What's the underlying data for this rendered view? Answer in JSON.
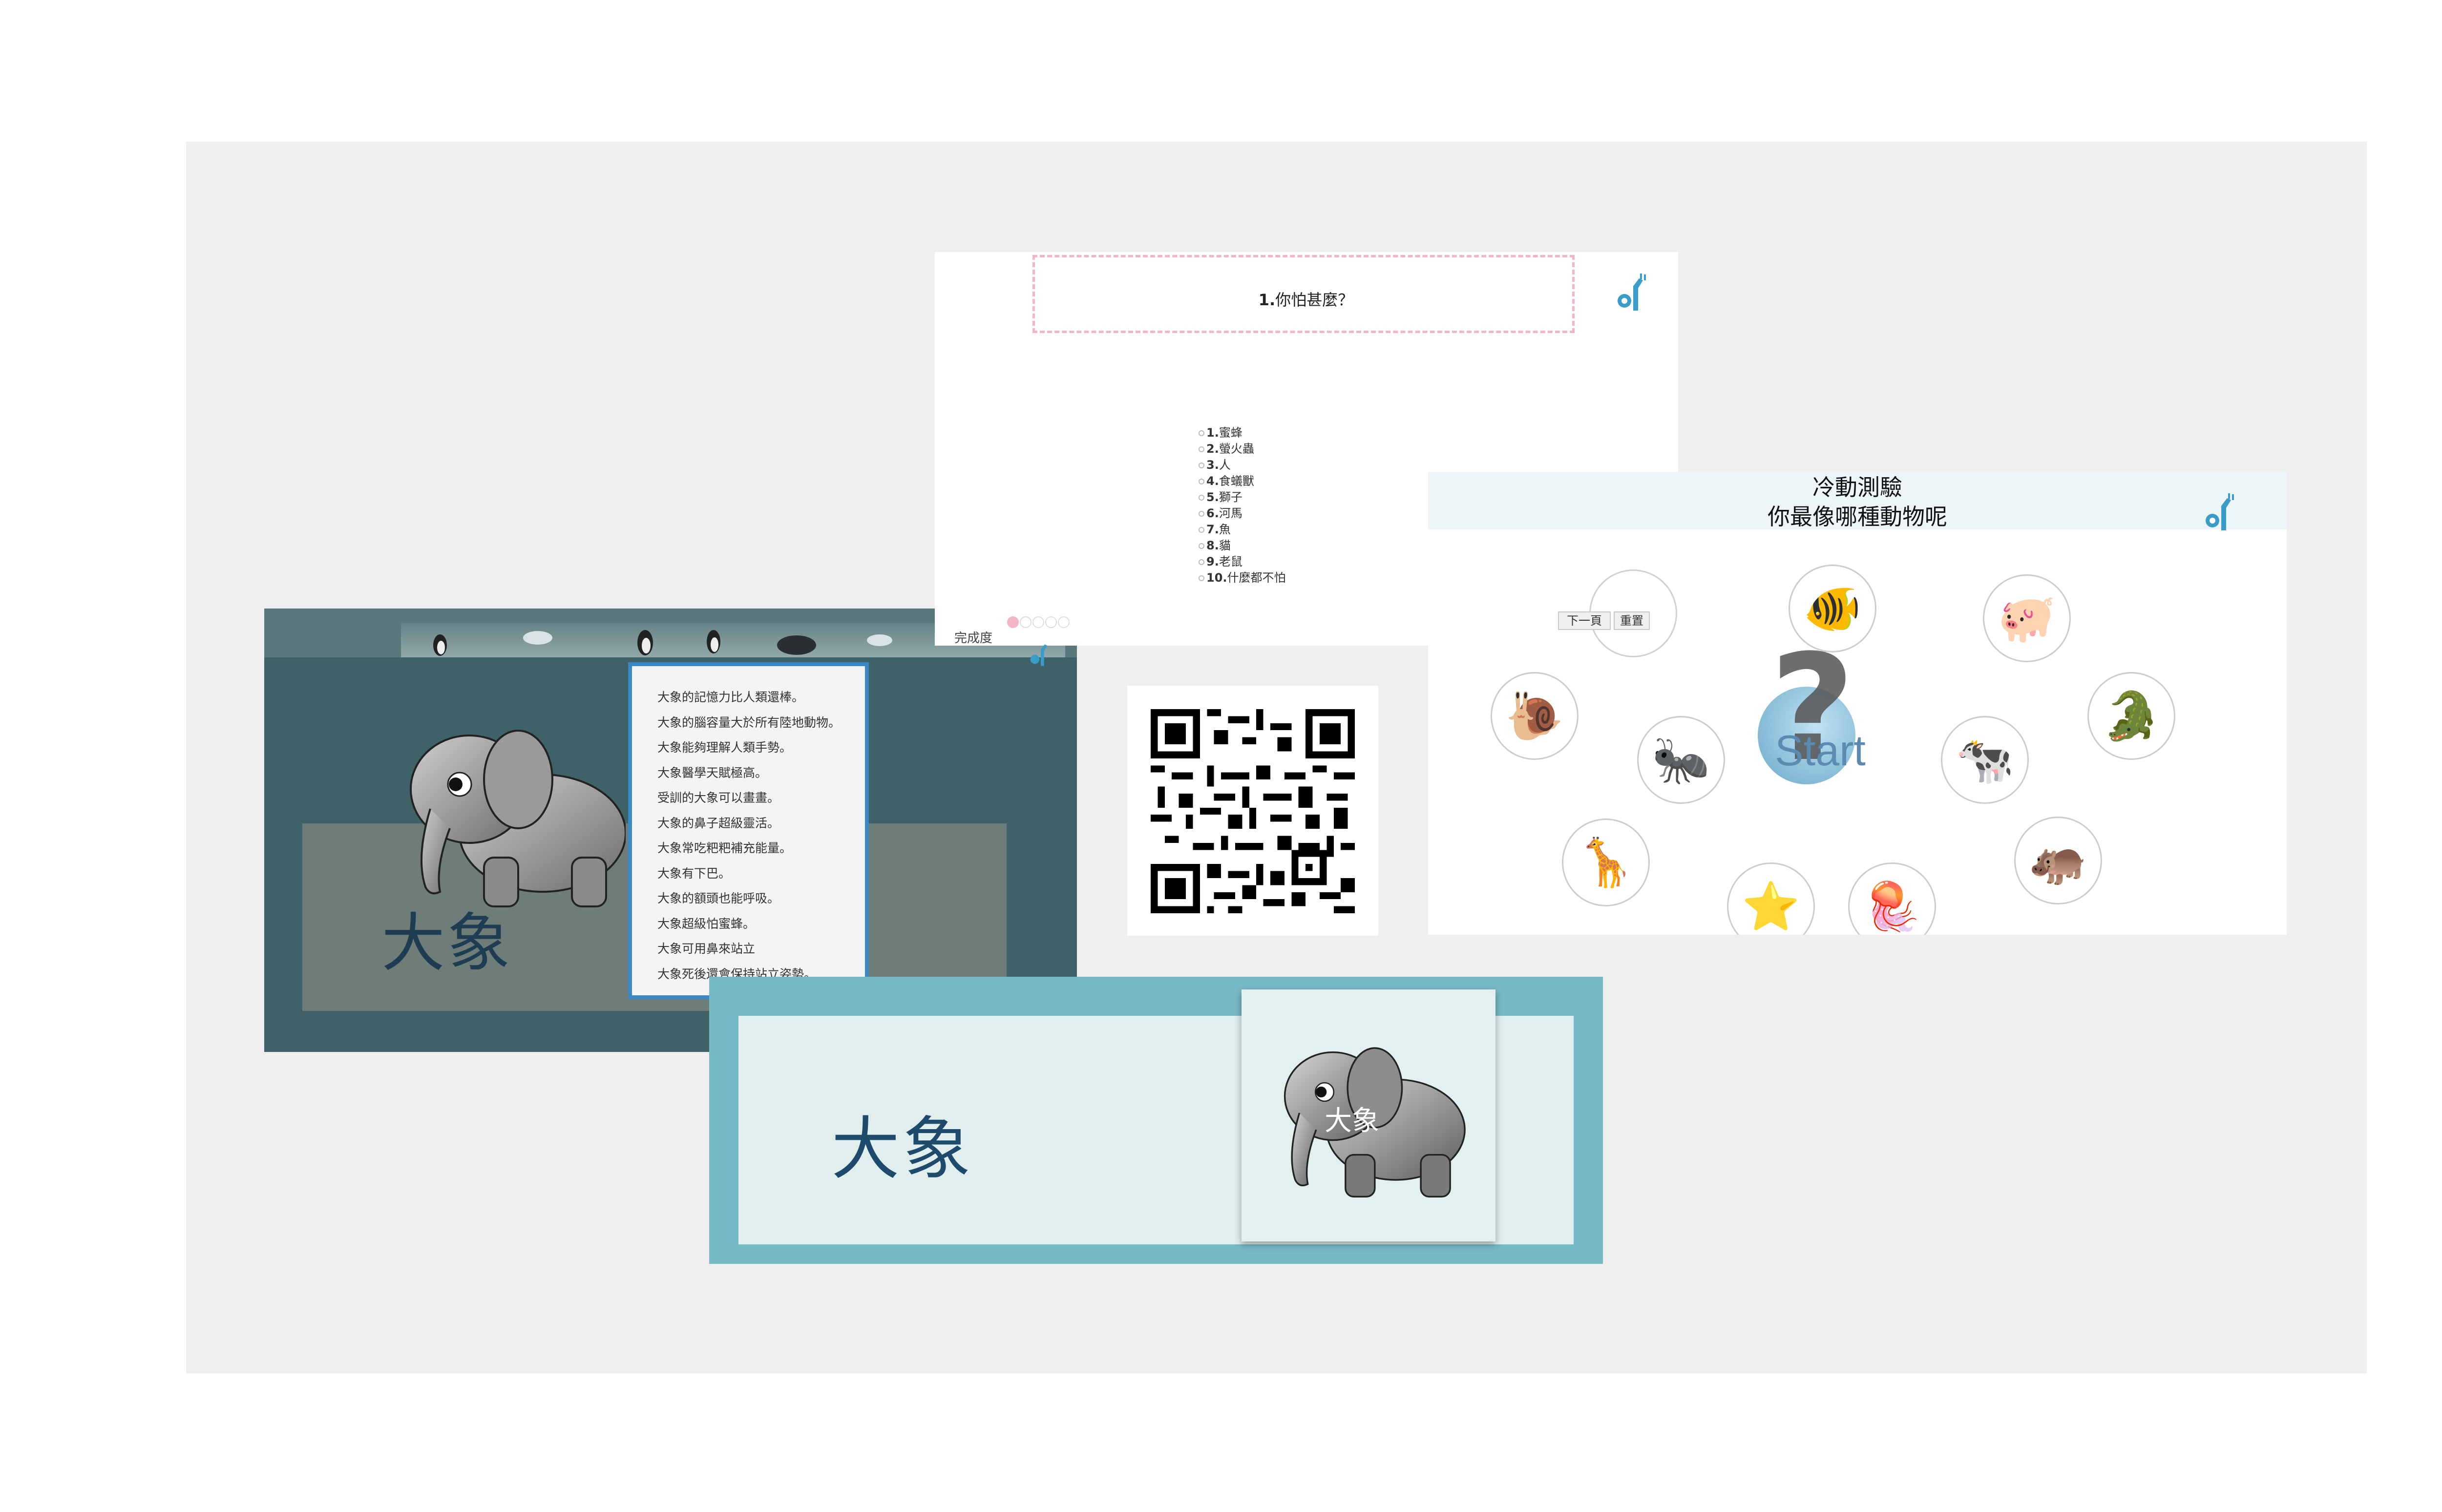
{
  "panel_facts": {
    "animal_label": "大象",
    "facts": [
      "大象的記憶力比人類還棒。",
      "大象的腦容量大於所有陸地動物。",
      "大象能夠理解人類手勢。",
      "大象醫學天賦極高。",
      "受訓的大象可以畫畫。",
      "大象的鼻子超級靈活。",
      "大象常吃粑粑補充能量。",
      "大象有下巴。",
      "大象的額頭也能呼吸。",
      "大象超級怕蜜蜂。",
      "大象可用鼻來站立",
      "大象死後還會保持站立姿勢。"
    ]
  },
  "panel_quiz": {
    "question_number": "1.",
    "question_text": "你怕甚麼？",
    "options": [
      {
        "num": "1.",
        "text": "蜜蜂"
      },
      {
        "num": "2.",
        "text": "螢火蟲"
      },
      {
        "num": "3.",
        "text": "人"
      },
      {
        "num": "4.",
        "text": "食蟻獸"
      },
      {
        "num": "5.",
        "text": "獅子"
      },
      {
        "num": "6.",
        "text": "河馬"
      },
      {
        "num": "7.",
        "text": "魚"
      },
      {
        "num": "8.",
        "text": "貓"
      },
      {
        "num": "9.",
        "text": "老鼠"
      },
      {
        "num": "10.",
        "text": "什麼都不怕"
      }
    ],
    "progress_label": "完成度",
    "progress_dots": 5,
    "progress_filled": 1,
    "accent_color": "#f2b6c4"
  },
  "panel_start": {
    "title_line1": "冷動測驗",
    "title_line2": "你最像哪種動物呢",
    "next_button": "下一頁",
    "reset_button": "重置",
    "start_label": "Start",
    "animals": [
      "goldfish-icon",
      "pig-icon",
      "snail-icon",
      "ant-icon",
      "cow-icon",
      "crocodile-icon",
      "giraffe-icon",
      "starfish-icon",
      "jellyfish-icon",
      "hippo-icon"
    ]
  },
  "panel_card": {
    "big_label": "大象",
    "photo_label": "大象"
  }
}
